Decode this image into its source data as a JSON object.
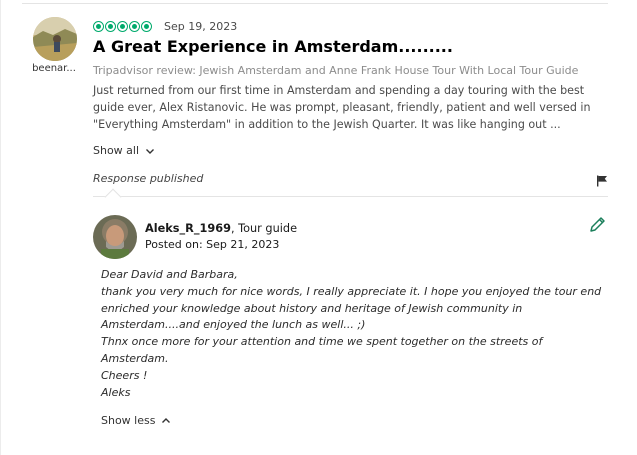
{
  "review": {
    "reviewer_name": "beenar...",
    "rating_bubbles": 5,
    "date": "Sep 19, 2023",
    "title": "A Great Experience in Amsterdam.........",
    "source": "Tripadvisor review: Jewish Amsterdam and Anne Frank House Tour With Local Tour Guide",
    "body": "Just returned from our first time in Amsterdam and spending a day touring with the best guide ever, Alex Ristanovic. He was prompt, pleasant, friendly, patient and well versed in \"Everything Amsterdam\" in addition to the Jewish Quarter. It was like hanging out ...",
    "show_all_label": "Show all"
  },
  "response": {
    "status_label": "Response published",
    "owner_name": "Aleks_R_1969",
    "owner_role": ", Tour guide",
    "posted": "Posted on: Sep 21, 2023",
    "lines": [
      "Dear David and Barbara,",
      "thank you very much for nice words, I really appreciate it. I hope you enjoyed the tour end enriched your knowledge about history and heritage of Jewish community in Amsterdam....and enjoyed the lunch as well... ;)",
      "Thnx once more for your attention and time we spent together on the streets of Amsterdam.",
      "Cheers !",
      "Aleks"
    ],
    "show_less_label": "Show less"
  },
  "colors": {
    "rating_green": "#00aa6c",
    "edit_icon_green": "#1b7f5b"
  },
  "icons": [
    "flag-icon",
    "edit-pencil-icon",
    "chevron-down-icon",
    "chevron-up-icon"
  ]
}
